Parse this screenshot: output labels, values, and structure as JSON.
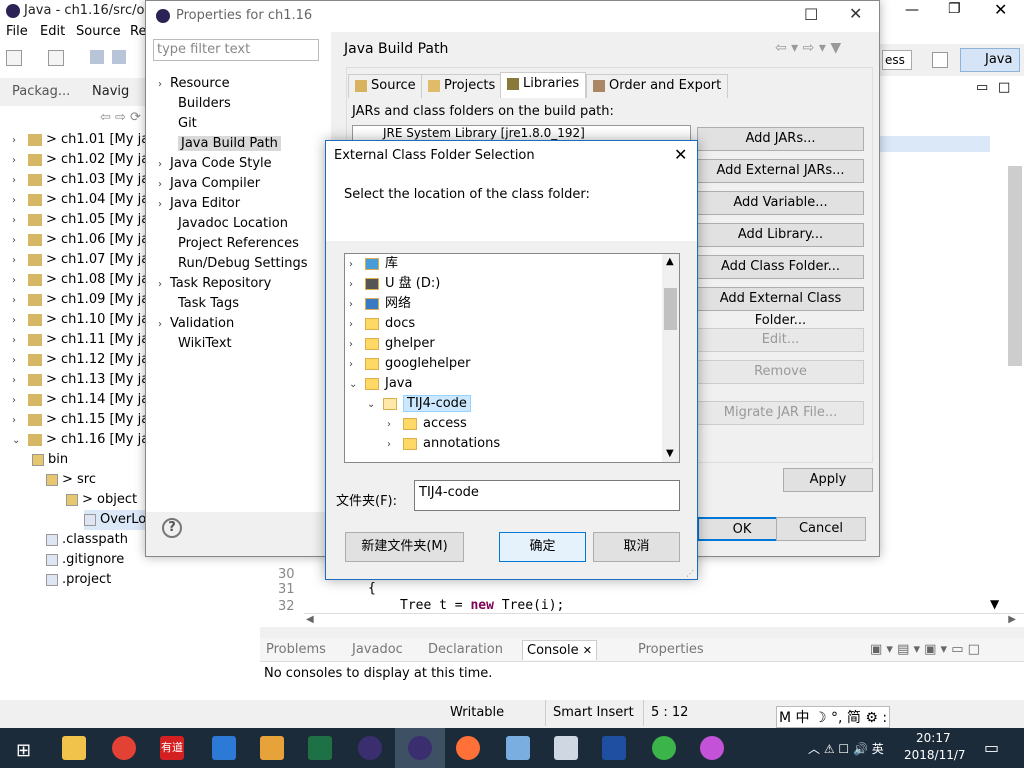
{
  "main_window": {
    "title": "Java - ch1.16/src/obj",
    "menu": [
      "File",
      "Edit",
      "Source",
      "Re"
    ],
    "views": {
      "package": "Packag...",
      "navigator": "Navig"
    },
    "quick_access": "ess",
    "perspective": "Java"
  },
  "project_tree": [
    {
      "label": "> ch1.01  [My jav"
    },
    {
      "label": "> ch1.02  [My jav"
    },
    {
      "label": "> ch1.03  [My jav"
    },
    {
      "label": "> ch1.04  [My jav"
    },
    {
      "label": "> ch1.05  [My jav"
    },
    {
      "label": "> ch1.06  [My jav"
    },
    {
      "label": "> ch1.07  [My jav"
    },
    {
      "label": "> ch1.08  [My jav"
    },
    {
      "label": "> ch1.09  [My jav"
    },
    {
      "label": "> ch1.10  [My jav"
    },
    {
      "label": "> ch1.11  [My jav"
    },
    {
      "label": "> ch1.12  [My jav"
    },
    {
      "label": "> ch1.13  [My jav"
    },
    {
      "label": "> ch1.14  [My jav"
    },
    {
      "label": "> ch1.15  [My jav"
    },
    {
      "label": "> ch1.16  [My jav"
    }
  ],
  "project_children": {
    "bin": "bin",
    "src": "> src",
    "object": "> object",
    "overlo": "OverLo",
    "classpath": ".classpath",
    "gitignore": ".gitignore",
    "project": ".project"
  },
  "properties": {
    "title": "Properties for ch1.16",
    "filter_placeholder": "type filter text",
    "nav": [
      "Resource",
      "Builders",
      "Git",
      "Java Build Path",
      "Java Code Style",
      "Java Compiler",
      "Java Editor",
      "Javadoc Location",
      "Project References",
      "Run/Debug Settings",
      "Task Repository",
      "Task Tags",
      "Validation",
      "WikiText"
    ],
    "header": "Java Build Path",
    "tabs": [
      "Source",
      "Projects",
      "Libraries",
      "Order and Export"
    ],
    "jars_label": "JARs and class folders on the build path:",
    "jre_item": "JRE System Library [jre1.8.0_192]",
    "buttons": {
      "add_jars": "Add JARs...",
      "add_ext_jars": "Add External JARs...",
      "add_variable": "Add Variable...",
      "add_library": "Add Library...",
      "add_class_folder": "Add Class Folder...",
      "add_ext_class_folder": "Add External Class Folder...",
      "edit": "Edit...",
      "remove": "Remove",
      "migrate": "Migrate JAR File...",
      "apply": "Apply",
      "ok": "OK",
      "cancel": "Cancel"
    }
  },
  "ext_dialog": {
    "title": "External Class Folder Selection",
    "prompt": "Select the location of the class folder:",
    "folders": [
      "库",
      "U 盘 (D:)",
      "网络",
      "docs",
      "ghelper",
      "googlehelper",
      "Java",
      "TIJ4-code",
      "access",
      "annotations"
    ],
    "folder_label": "文件夹(F):",
    "folder_value": "TIJ4-code",
    "new_folder": "新建文件夹(M)",
    "ok": "确定",
    "cancel": "取消"
  },
  "editor": {
    "lines": [
      "30",
      "31",
      "32"
    ],
    "code_line31": "{",
    "code_line32_a": "Tree t = ",
    "code_line32_kw": "new",
    "code_line32_b": " Tree(i);"
  },
  "console_tabs": [
    "Problems",
    "Javadoc",
    "Declaration",
    "Console",
    "Properties"
  ],
  "console_msg": "No consoles to display at this time.",
  "status": {
    "writable": "Writable",
    "insert": "Smart Insert",
    "pos": "5 : 12"
  },
  "ime": "M 中 ☽ °, 简 ⚙ :",
  "clock": {
    "time": "20:17",
    "date": "2018/11/7"
  },
  "taskbar_youdao": "有道"
}
